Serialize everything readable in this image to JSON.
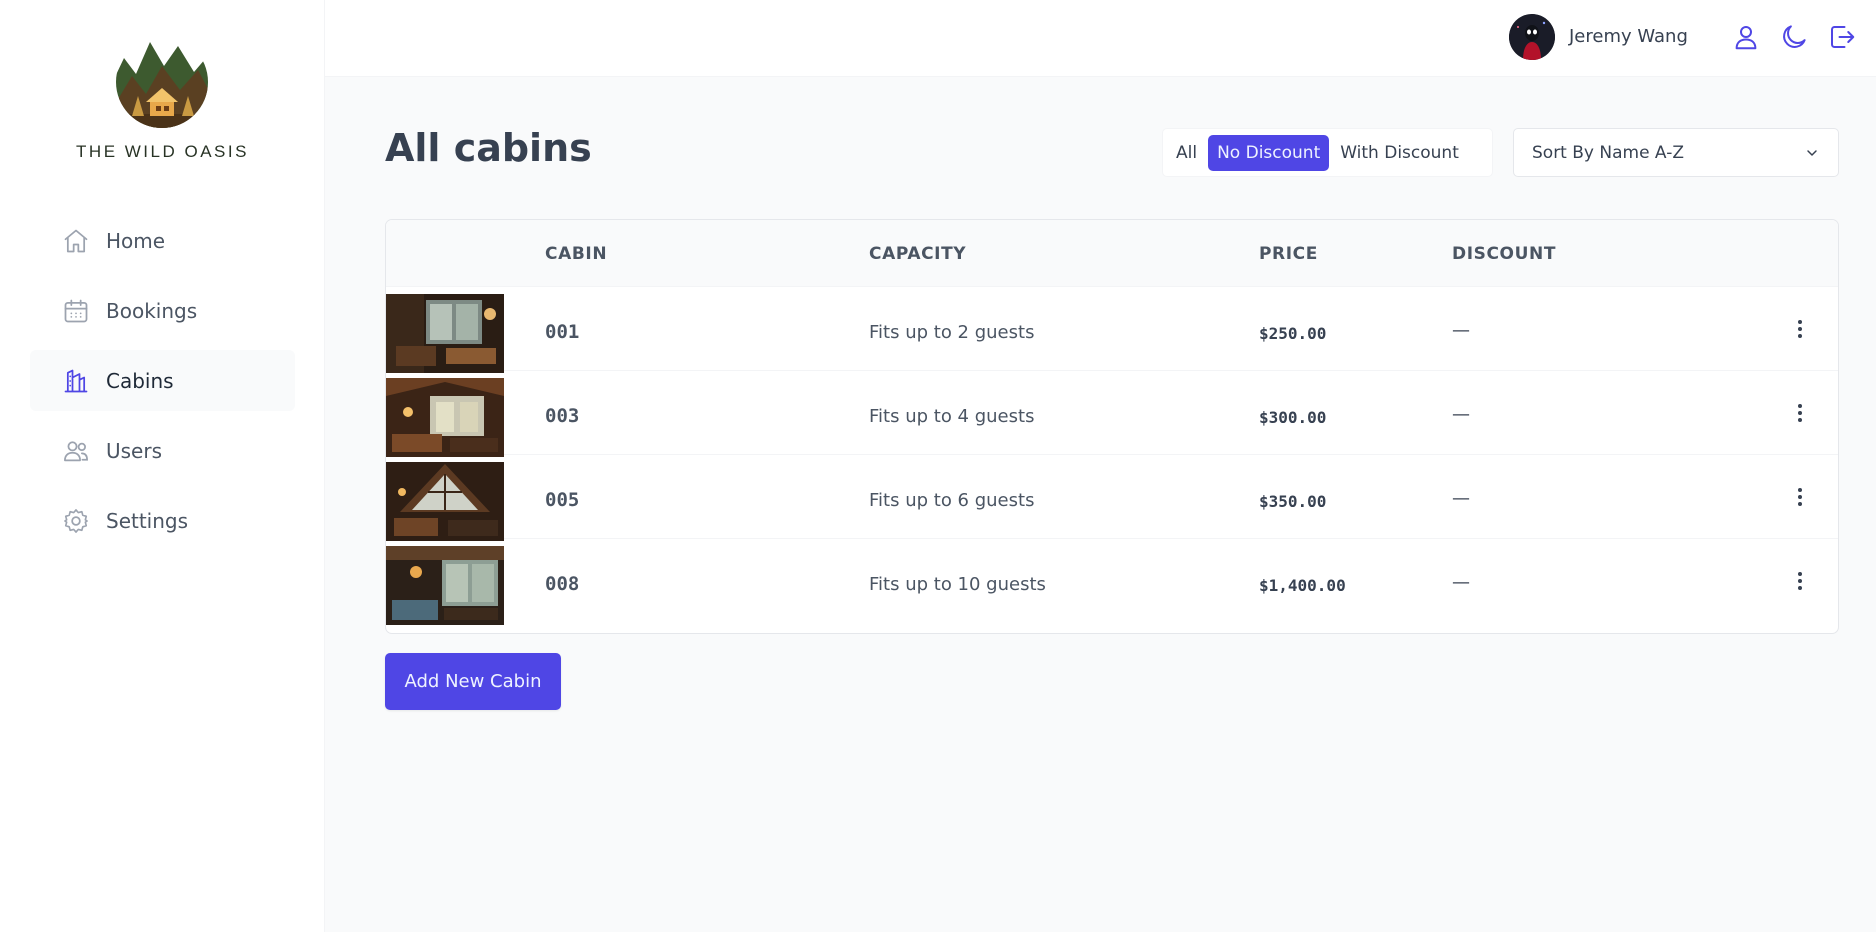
{
  "brand": {
    "name": "THE WILD OASIS"
  },
  "sidebar": {
    "items": [
      {
        "label": "Home",
        "icon": "home-icon"
      },
      {
        "label": "Bookings",
        "icon": "calendar-icon"
      },
      {
        "label": "Cabins",
        "icon": "cabins-icon",
        "active": true
      },
      {
        "label": "Users",
        "icon": "users-icon"
      },
      {
        "label": "Settings",
        "icon": "gear-icon"
      }
    ]
  },
  "header": {
    "user_name": "Jeremy Wang",
    "actions": [
      "user-icon",
      "moon-icon",
      "logout-icon"
    ]
  },
  "main": {
    "title": "All cabins",
    "filter": {
      "options": [
        "All",
        "No Discount",
        "With Discount"
      ],
      "active": "No Discount"
    },
    "sort": {
      "selected": "Sort By Name A-Z"
    },
    "table": {
      "columns": [
        "",
        "CABIN",
        "CAPACITY",
        "PRICE",
        "DISCOUNT"
      ],
      "rows": [
        {
          "name": "001",
          "capacity": "Fits up to 2 guests",
          "price": "$250.00",
          "discount": "—"
        },
        {
          "name": "003",
          "capacity": "Fits up to 4 guests",
          "price": "$300.00",
          "discount": "—"
        },
        {
          "name": "005",
          "capacity": "Fits up to 6 guests",
          "price": "$350.00",
          "discount": "—"
        },
        {
          "name": "008",
          "capacity": "Fits up to 10 guests",
          "price": "$1,400.00",
          "discount": "—"
        }
      ]
    },
    "add_button": "Add New Cabin"
  },
  "colors": {
    "accent": "#4f46e5",
    "background": "#f9fafb",
    "text": "#374151",
    "brand_text": "#283325"
  }
}
